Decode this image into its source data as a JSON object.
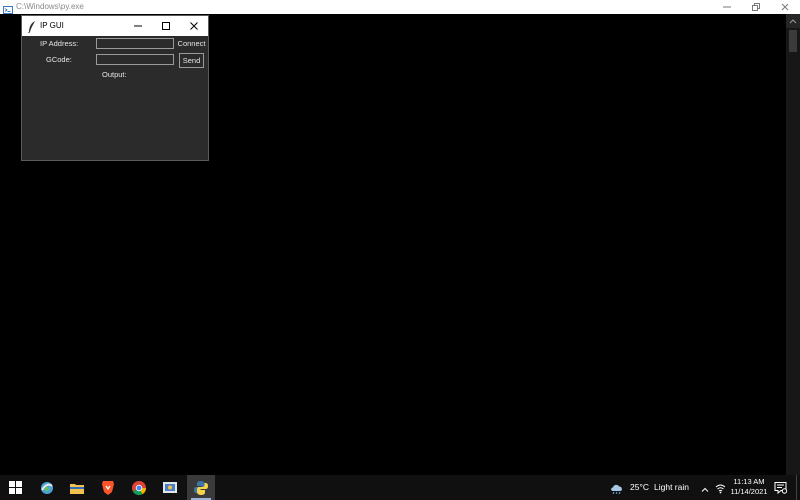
{
  "console_window": {
    "title": "C:\\Windows\\py.exe"
  },
  "app_window": {
    "title": "IP GUI",
    "ip_label": "IP Address:",
    "ip_value": "",
    "connect_label": "Connect",
    "gcode_label": "GCode:",
    "gcode_value": "",
    "send_label": "Send",
    "output_label": "Output:"
  },
  "taskbar": {
    "pinned_icons": [
      "windows-start-icon",
      "app-icon",
      "file-explorer-icon",
      "brave-browser-icon",
      "chrome-icon",
      "app-icon-2",
      "python-icon"
    ],
    "active_icon": "python-icon",
    "weather": {
      "temperature": "25°C",
      "condition": "Light rain"
    },
    "clock": {
      "time": "11:13 AM",
      "date": "11/14/2021"
    }
  },
  "colors": {
    "console_background": "#000000",
    "app_background": "#2b2b2b",
    "taskbar_background": "#101010",
    "active_accent": "#9ab4d8"
  }
}
